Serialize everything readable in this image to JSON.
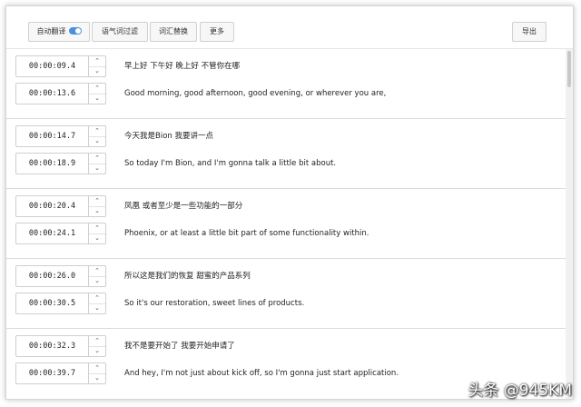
{
  "toolbar": {
    "auto_translate_label": "自动翻译",
    "auto_translate_enabled": true,
    "filter_label": "语气词过滤",
    "replace_label": "词汇替换",
    "more_label": "更多",
    "export_label": "导出"
  },
  "segments": [
    {
      "start_time": "00:00:09.4",
      "end_time": "00:00:13.6",
      "source_text": "早上好 下午好 晚上好 不管你在哪",
      "translation_text": "Good morning, good afternoon, good evening, or wherever you are,"
    },
    {
      "start_time": "00:00:14.7",
      "end_time": "00:00:18.9",
      "source_text": "今天我是Bion 我要讲一点",
      "translation_text": "So today I'm Bion, and I'm gonna talk a little bit about."
    },
    {
      "start_time": "00:00:20.4",
      "end_time": "00:00:24.1",
      "source_text": "凤凰 或者至少是一些功能的一部分",
      "translation_text": "Phoenix, or at least a little bit part of some functionality within."
    },
    {
      "start_time": "00:00:26.0",
      "end_time": "00:00:30.5",
      "source_text": "所以这是我们的恢复 甜蜜的产品系列",
      "translation_text": "So it's our restoration, sweet lines of products."
    },
    {
      "start_time": "00:00:32.3",
      "end_time": "00:00:39.7",
      "source_text": "我不是要开始了 我要开始申请了",
      "translation_text": "And hey, I'm not just about kick off, so I'm gonna just start application."
    }
  ],
  "stepper": {
    "up_icon": "chevron-up",
    "down_icon": "chevron-down"
  },
  "watermark": "头条 @945KM",
  "colors": {
    "toggle_on": "#4a90e2",
    "border": "#cfcfcf",
    "divider": "#dcdcdc"
  }
}
